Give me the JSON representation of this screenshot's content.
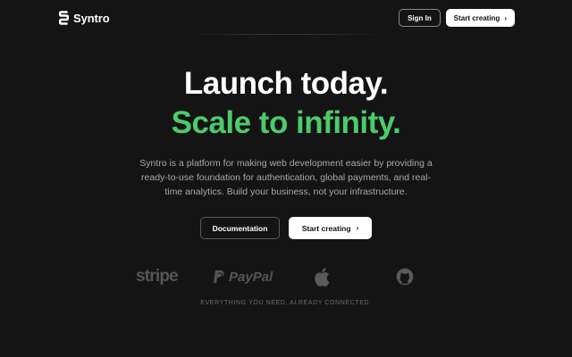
{
  "header": {
    "brand": "Syntro",
    "signin_label": "Sign In",
    "start_label": "Start creating"
  },
  "hero": {
    "title_line1": "Launch today.",
    "title_line2": "Scale to infinity.",
    "description": "Syntro is a platform for making web development easier by providing a ready-to-use foundation for authentication, global payments, and real-time analytics. Build your business, not your infrastructure.",
    "docs_label": "Documentation",
    "start_label": "Start creating"
  },
  "logos": {
    "stripe": "stripe",
    "paypal": "PayPal",
    "tagline": "EVERYTHING YOU NEED, ALREADY CONNECTED."
  },
  "colors": {
    "background": "#141414",
    "accent_green": "#4ccb6b",
    "muted_text": "#a9a9a9",
    "logo_gray": "#555555"
  },
  "icons": {
    "brand": "syntro-logo-icon",
    "chevron": "chevron-right-icon",
    "apple": "apple-icon",
    "github": "github-icon",
    "paypal": "paypal-icon"
  }
}
